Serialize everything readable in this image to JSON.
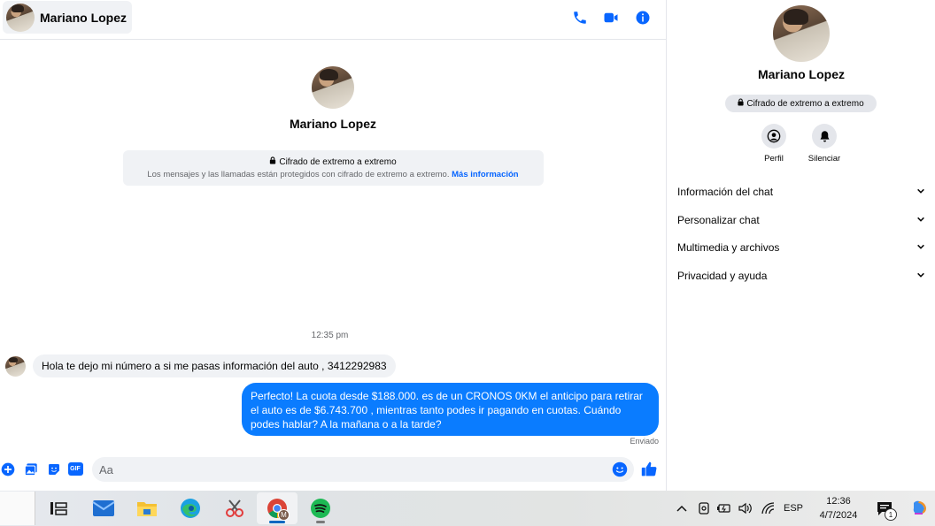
{
  "header": {
    "contact_name": "Mariano Lopez"
  },
  "intro": {
    "name": "Mariano Lopez",
    "e2e_title": "Cifrado de extremo a extremo",
    "e2e_desc": "Los mensajes y las llamadas están protegidos con cifrado de extremo a extremo.",
    "e2e_link": "Más información"
  },
  "messages": {
    "timestamp": "12:35 pm",
    "incoming_text": "Hola te dejo mi número a si me pasas información del auto , 3412292983",
    "outgoing_text": "Perfecto! La cuota desde $188.000. es de un CRONOS 0KM el anticipo para retirar el auto es de $6.743.700 , mientras tanto podes ir pagando en cuotas. Cuándo podes hablar? A la mañana o a la tarde?",
    "status": "Enviado"
  },
  "composer": {
    "placeholder": "Aa",
    "gif_label": "GIF"
  },
  "panel": {
    "name": "Mariano Lopez",
    "e2e_badge": "Cifrado de extremo a extremo",
    "actions": [
      {
        "label": "Perfil",
        "icon": "profile-icon"
      },
      {
        "label": "Silenciar",
        "icon": "bell-icon"
      }
    ],
    "sections": [
      "Información del chat",
      "Personalizar chat",
      "Multimedia y archivos",
      "Privacidad y ayuda"
    ]
  },
  "taskbar": {
    "language": "ESP",
    "time": "12:36",
    "date": "4/7/2024",
    "notification_count": "1",
    "chrome_profile_letter": "M"
  },
  "colors": {
    "accent": "#0866ff",
    "outgoing_bubble": "#0a7cff",
    "incoming_bubble": "#f0f2f5"
  }
}
